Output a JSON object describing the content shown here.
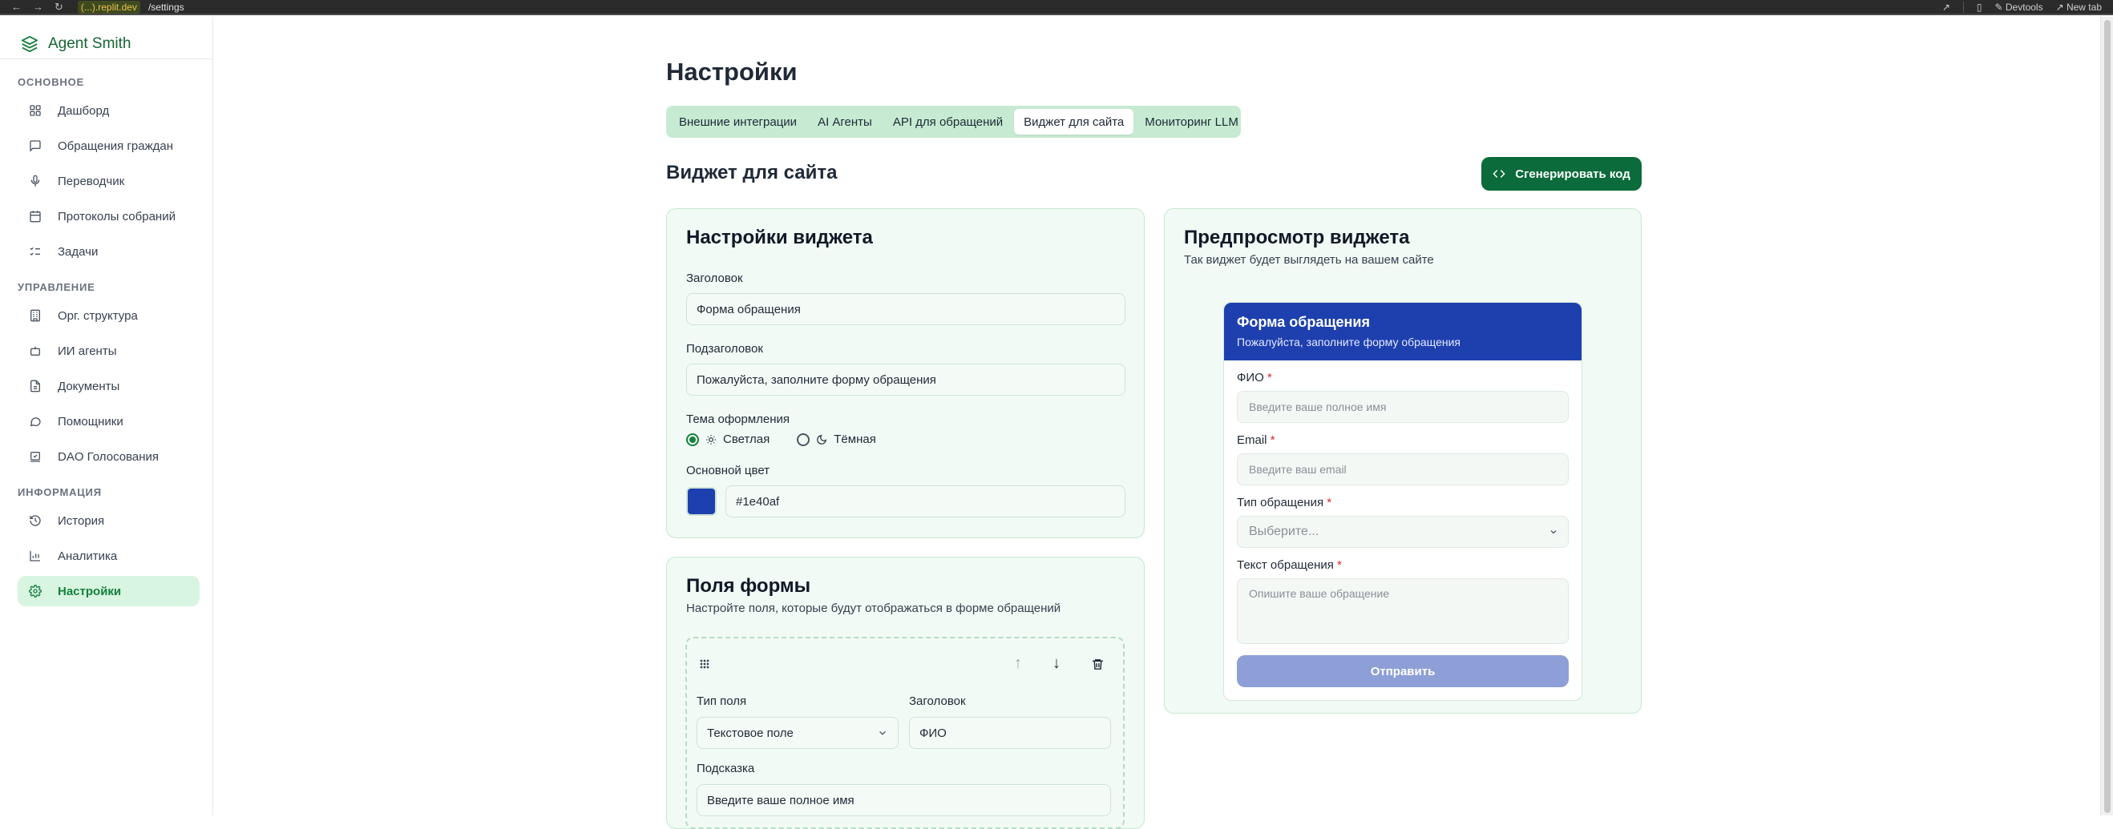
{
  "browser": {
    "host": "(...).replit.dev",
    "path": "/settings",
    "devtools_label": "Devtools",
    "new_tab_label": "New tab"
  },
  "sidebar": {
    "brand": "Agent Smith",
    "sections": [
      {
        "title": "ОСНОВНОЕ",
        "items": [
          {
            "label": "Дашборд",
            "icon": "grid-icon"
          },
          {
            "label": "Обращения граждан",
            "icon": "message-icon"
          },
          {
            "label": "Переводчик",
            "icon": "mic-icon"
          },
          {
            "label": "Протоколы собраний",
            "icon": "calendar-icon"
          },
          {
            "label": "Задачи",
            "icon": "checklist-icon"
          }
        ]
      },
      {
        "title": "УПРАВЛЕНИЕ",
        "items": [
          {
            "label": "Орг. структура",
            "icon": "building-icon"
          },
          {
            "label": "ИИ агенты",
            "icon": "bot-icon"
          },
          {
            "label": "Документы",
            "icon": "document-icon"
          },
          {
            "label": "Помощники",
            "icon": "chat-bubble-icon"
          },
          {
            "label": "DAO Голосования",
            "icon": "vote-icon"
          }
        ]
      },
      {
        "title": "ИНФОРМАЦИЯ",
        "items": [
          {
            "label": "История",
            "icon": "history-icon"
          },
          {
            "label": "Аналитика",
            "icon": "bar-chart-icon"
          },
          {
            "label": "Настройки",
            "icon": "gear-icon",
            "active": true
          }
        ]
      }
    ]
  },
  "main": {
    "title": "Настройки",
    "tabs": [
      {
        "label": "Внешние интеграции"
      },
      {
        "label": "AI Агенты"
      },
      {
        "label": "API для обращений"
      },
      {
        "label": "Виджет для сайта",
        "active": true
      },
      {
        "label": "Мониторинг LLM"
      }
    ],
    "section_title": "Виджет для сайта",
    "generate_button": "Сгенерировать код"
  },
  "widget_settings": {
    "title": "Настройки виджета",
    "heading_label": "Заголовок",
    "heading_value": "Форма обращения",
    "subheading_label": "Подзаголовок",
    "subheading_value": "Пожалуйста, заполните форму обращения",
    "theme_label": "Тема оформления",
    "theme_light": "Светлая",
    "theme_dark": "Тёмная",
    "theme_selected": "light",
    "color_label": "Основной цвет",
    "color_value": "#1e40af"
  },
  "form_fields": {
    "title": "Поля формы",
    "subtitle": "Настройте поля, которые будут отображаться в форме обращений",
    "field": {
      "type_label": "Тип поля",
      "type_value": "Текстовое поле",
      "heading_label": "Заголовок",
      "heading_value": "ФИО",
      "hint_label": "Подсказка",
      "hint_value": "Введите ваше полное имя"
    }
  },
  "preview": {
    "title": "Предпросмотр виджета",
    "subtitle": "Так виджет будет выглядеть на вашем сайте",
    "widget": {
      "title": "Форма обращения",
      "subtitle": "Пожалуйста, заполните форму обращения",
      "name_label": "ФИО",
      "name_placeholder": "Введите ваше полное имя",
      "email_label": "Email",
      "email_placeholder": "Введите ваш email",
      "type_label": "Тип обращения",
      "type_placeholder": "Выберите...",
      "text_label": "Текст обращения",
      "text_placeholder": "Опишите ваше обращение",
      "submit": "Отправить",
      "required_mark": "*"
    }
  },
  "colors": {
    "brand_green": "#15803d",
    "button_green": "#0b6b3a",
    "widget_blue": "#1e40af",
    "active_nav_bg": "#d8f5e1"
  }
}
